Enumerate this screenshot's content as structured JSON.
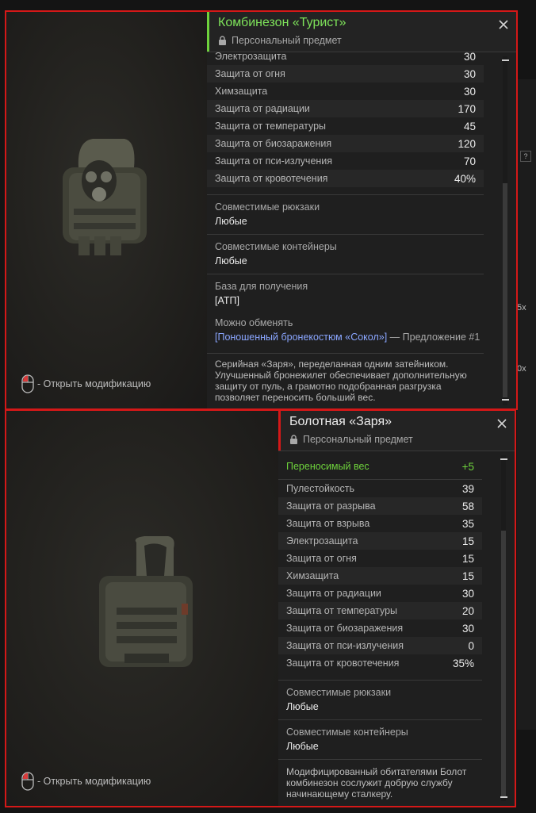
{
  "hint_text": "- Открыть модификацию",
  "card1": {
    "title": "Комбинезон «Турист»",
    "subtitle": "Персональный предмет",
    "stats": [
      {
        "label": "Электрозащита",
        "value": "30"
      },
      {
        "label": "Защита от огня",
        "value": "30"
      },
      {
        "label": "Химзащита",
        "value": "30"
      },
      {
        "label": "Защита от радиации",
        "value": "170"
      },
      {
        "label": "Защита от температуры",
        "value": "45"
      },
      {
        "label": "Защита от биозаражения",
        "value": "120"
      },
      {
        "label": "Защита от пси-излучения",
        "value": "70"
      },
      {
        "label": "Защита от кровотечения",
        "value": "40%"
      }
    ],
    "backpacks_label": "Совместимые рюкзаки",
    "backpacks_value": "Любые",
    "containers_label": "Совместимые контейнеры",
    "containers_value": "Любые",
    "base_label": "База для получения",
    "base_value": "[АТП]",
    "exchange_label": "Можно обменять",
    "exchange_link": "[Поношенный бронекостюм «Сокол»]",
    "exchange_suffix": " — Предложение #1",
    "description": "Серийная «Заря», переделанная одним затейником. Улучшенный бронежилет обеспечивает дополнительную защиту от пуль, а грамотно подобранная разгрузка позволяет переносить больший вес."
  },
  "card2": {
    "title": "Болотная «Заря»",
    "subtitle": "Персональный предмет",
    "carry_label": "Переносимый вес",
    "carry_value": "+5",
    "stats": [
      {
        "label": "Пулестойкость",
        "value": "39"
      },
      {
        "label": "Защита от разрыва",
        "value": "58"
      },
      {
        "label": "Защита от взрыва",
        "value": "35"
      },
      {
        "label": "Электрозащита",
        "value": "15"
      },
      {
        "label": "Защита от огня",
        "value": "15"
      },
      {
        "label": "Химзащита",
        "value": "15"
      },
      {
        "label": "Защита от радиации",
        "value": "30"
      },
      {
        "label": "Защита от температуры",
        "value": "20"
      },
      {
        "label": "Защита от биозаражения",
        "value": "30"
      },
      {
        "label": "Защита от пси-излучения",
        "value": "0"
      },
      {
        "label": "Защита от кровотечения",
        "value": "35%"
      }
    ],
    "backpacks_label": "Совместимые рюкзаки",
    "backpacks_value": "Любые",
    "containers_label": "Совместимые контейнеры",
    "containers_value": "Любые",
    "description": "Модифицированный обитателями Болот комбинезон сослужит добрую службу начинающему сталкеру."
  },
  "side_fragments": [
    "5x",
    "0x",
    "?"
  ],
  "colors": {
    "accent_green": "#6ed23c",
    "frame_red": "#d41818",
    "link_blue": "#8aa6ff"
  }
}
